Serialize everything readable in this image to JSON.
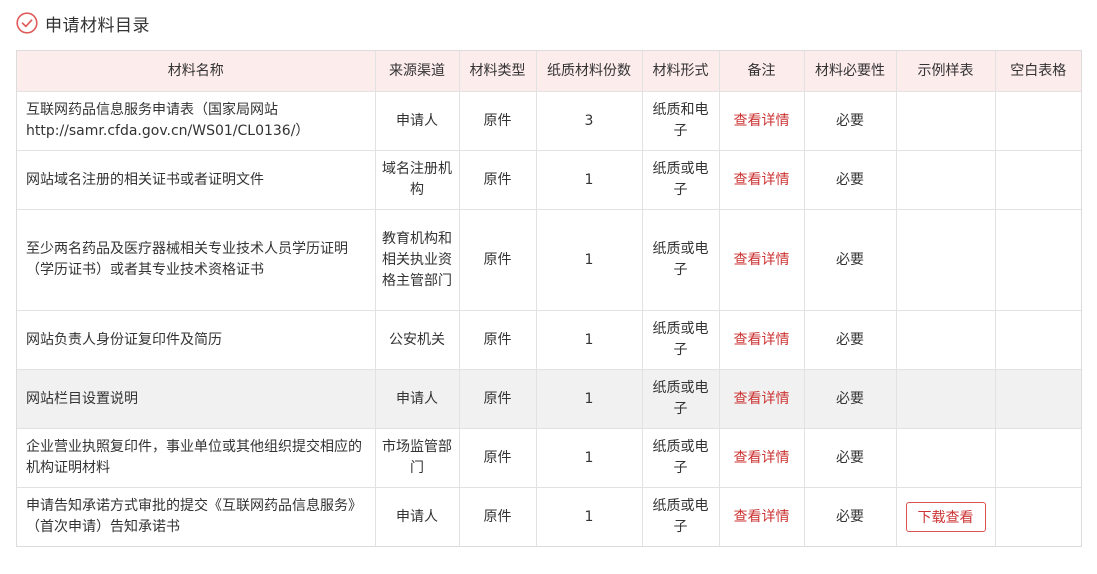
{
  "section": {
    "title": "申请材料目录",
    "icon": "check-circle-icon",
    "accent_color": "#e05a5a"
  },
  "table": {
    "headers": [
      "材料名称",
      "来源渠道",
      "材料类型",
      "纸质材料份数",
      "材料形式",
      "备注",
      "材料必要性",
      "示例样表",
      "空白表格"
    ],
    "rows": [
      {
        "name": "互联网药品信息服务申请表（国家局网站http://samr.cfda.gov.cn/WS01/CL0136/）",
        "source": "申请人",
        "type": "原件",
        "copies": "3",
        "form": "纸质和电子",
        "remark": "查看详情",
        "necessity": "必要",
        "sample": "",
        "blank": ""
      },
      {
        "name": "网站域名注册的相关证书或者证明文件",
        "source": "域名注册机构",
        "type": "原件",
        "copies": "1",
        "form": "纸质或电子",
        "remark": "查看详情",
        "necessity": "必要",
        "sample": "",
        "blank": ""
      },
      {
        "name": "至少两名药品及医疗器械相关专业技术人员学历证明（学历证书）或者其专业技术资格证书",
        "source": "教育机构和相关执业资格主管部门",
        "type": "原件",
        "copies": "1",
        "form": "纸质或电子",
        "remark": "查看详情",
        "necessity": "必要",
        "sample": "",
        "blank": ""
      },
      {
        "name": "网站负责人身份证复印件及简历",
        "source": "公安机关",
        "type": "原件",
        "copies": "1",
        "form": "纸质或电子",
        "remark": "查看详情",
        "necessity": "必要",
        "sample": "",
        "blank": ""
      },
      {
        "name": "网站栏目设置说明",
        "source": "申请人",
        "type": "原件",
        "copies": "1",
        "form": "纸质或电子",
        "remark": "查看详情",
        "necessity": "必要",
        "sample": "",
        "blank": ""
      },
      {
        "name": "企业营业执照复印件，事业单位或其他组织提交相应的机构证明材料",
        "source": "市场监管部门",
        "type": "原件",
        "copies": "1",
        "form": "纸质或电子",
        "remark": "查看详情",
        "necessity": "必要",
        "sample": "",
        "blank": ""
      },
      {
        "name": "申请告知承诺方式审批的提交《互联网药品信息服务》（首次申请）告知承诺书",
        "source": "申请人",
        "type": "原件",
        "copies": "1",
        "form": "纸质或电子",
        "remark": "查看详情",
        "necessity": "必要",
        "sample": "下载查看",
        "blank": ""
      }
    ]
  }
}
